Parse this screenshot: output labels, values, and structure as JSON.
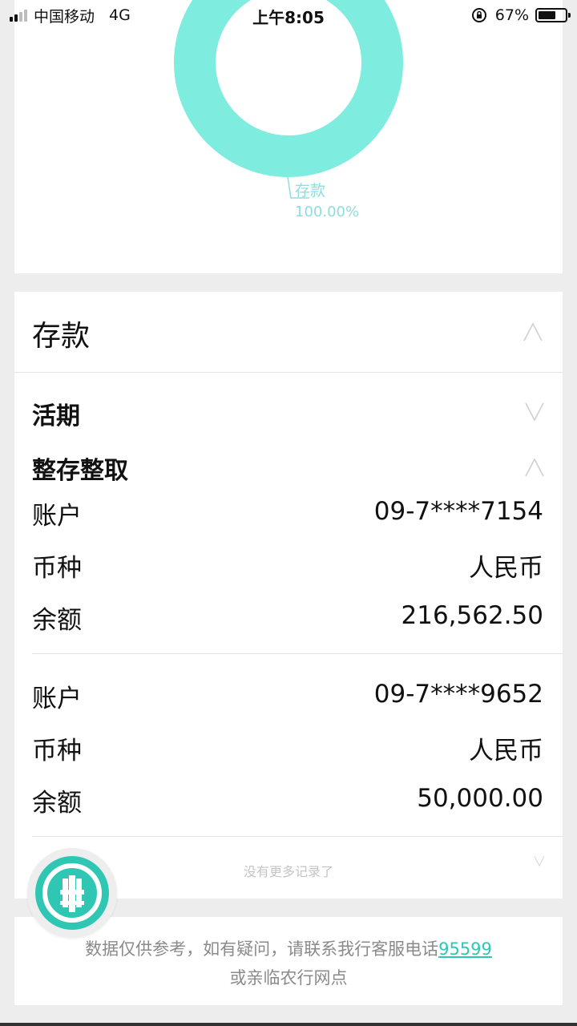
{
  "status_bar": {
    "carrier": "中国移动",
    "network": "4G",
    "time": "上午8:05",
    "battery_percent": "67%",
    "battery_level": 0.67,
    "signal_bars_active": 2,
    "signal_bars_total": 4
  },
  "chart_data": {
    "type": "pie",
    "style": "donut",
    "slices": [
      {
        "label": "存款",
        "value": 100.0,
        "percent_label": "100.00%",
        "color": "#7eecdf"
      }
    ]
  },
  "deposit": {
    "title": "存款",
    "sections": [
      {
        "label": "活期",
        "expanded": false
      },
      {
        "label": "整存整取",
        "expanded": true
      }
    ],
    "accounts": [
      {
        "account_label": "账户",
        "account_value": "09-7****7154",
        "currency_label": "币种",
        "currency_value": "人民币",
        "balance_label": "余额",
        "balance_value": "216,562.50"
      },
      {
        "account_label": "账户",
        "account_value": "09-7****9652",
        "currency_label": "币种",
        "currency_value": "人民币",
        "balance_label": "余额",
        "balance_value": "50,000.00"
      }
    ],
    "no_more_records": "没有更多记录了"
  },
  "footer": {
    "disclaimer_prefix": "数据仅供参考，如有疑问，请联系我行客服电话",
    "phone": "95599",
    "disclaimer_line2": "或亲临农行网点"
  },
  "colors": {
    "accent": "#2fc7b3",
    "donut": "#7eecdf",
    "chart_label": "#8fdde0"
  },
  "icons": {
    "collapse": "chevron-up-icon",
    "expand": "chevron-down-icon",
    "bank_logo": "abc-bank-logo-icon",
    "lock": "rotation-lock-icon"
  }
}
